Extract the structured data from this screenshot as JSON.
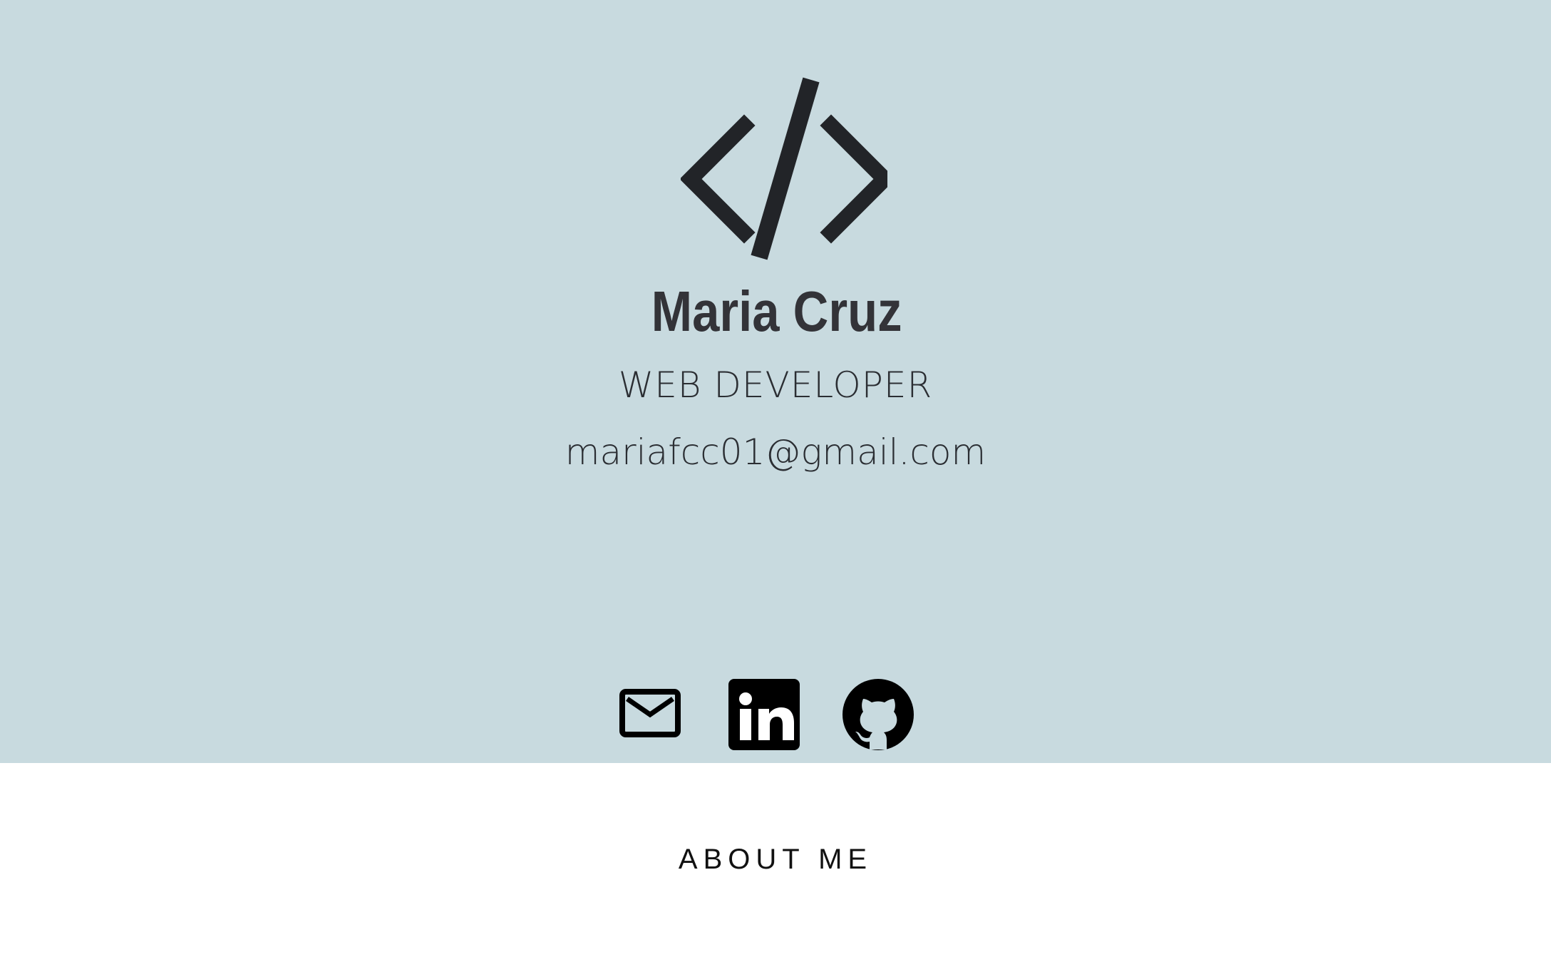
{
  "hero": {
    "name": "Maria Cruz",
    "role": "WEB DEVELOPER",
    "email": "mariafcc01@gmail.com",
    "logo_icon": "code-icon",
    "background_color": "#c8dadf",
    "text_color": "#333338"
  },
  "social": [
    {
      "icon": "mail-icon"
    },
    {
      "icon": "linkedin-icon"
    },
    {
      "icon": "github-icon"
    }
  ],
  "about": {
    "title": "ABOUT ME"
  }
}
